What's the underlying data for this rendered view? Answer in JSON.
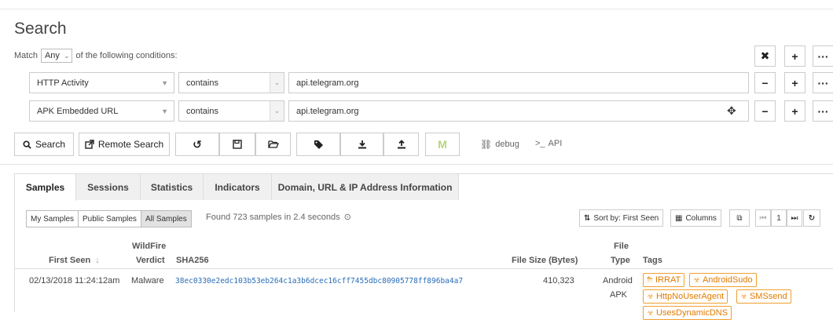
{
  "header": {
    "title": "Search"
  },
  "match": {
    "prefix": "Match",
    "mode": "Any",
    "suffix": "of the following conditions:"
  },
  "conditions": [
    {
      "field": "HTTP Activity",
      "operator": "contains",
      "value": "api.telegram.org"
    },
    {
      "field": "APK Embedded URL",
      "operator": "contains",
      "value": "api.telegram.org"
    }
  ],
  "toolbar": {
    "search_label": "Search",
    "remote_label": "Remote Search",
    "debug_label": "debug",
    "api_label": "API"
  },
  "tabs": [
    "Samples",
    "Sessions",
    "Statistics",
    "Indicators",
    "Domain, URL & IP Address Information"
  ],
  "scope": [
    "My Samples",
    "Public Samples",
    "All Samples"
  ],
  "results": {
    "found_text": "Found 723 samples in 2.4 seconds"
  },
  "controls": {
    "sort_label": "Sort by: First Seen",
    "columns_label": "Columns",
    "page": "1"
  },
  "columns": {
    "first_seen": "First Seen",
    "verdict_1": "WildFire",
    "verdict_2": "Verdict",
    "sha": "SHA256",
    "size": "File Size (Bytes)",
    "type_1": "File",
    "type_2": "Type",
    "tags": "Tags"
  },
  "rows": [
    {
      "first_seen": "02/13/2018 11:24:12am",
      "verdict": "Malware",
      "sha256": "38ec0330e2edc103b53eb264c1a3b6dcec16cff7455dbc80905778ff896ba4a7",
      "size": "410,323",
      "type_1": "Android",
      "type_2": "APK",
      "tags": [
        "IRRAT",
        "AndroidSudo",
        "HttpNoUserAgent",
        "SMSsend",
        "UsesDynamicDNS"
      ]
    }
  ],
  "colors": {
    "accent": "#2a6db5",
    "tag": "#e07b00",
    "tag_border": "#f0a030",
    "highlight": "#c8e6a0"
  }
}
